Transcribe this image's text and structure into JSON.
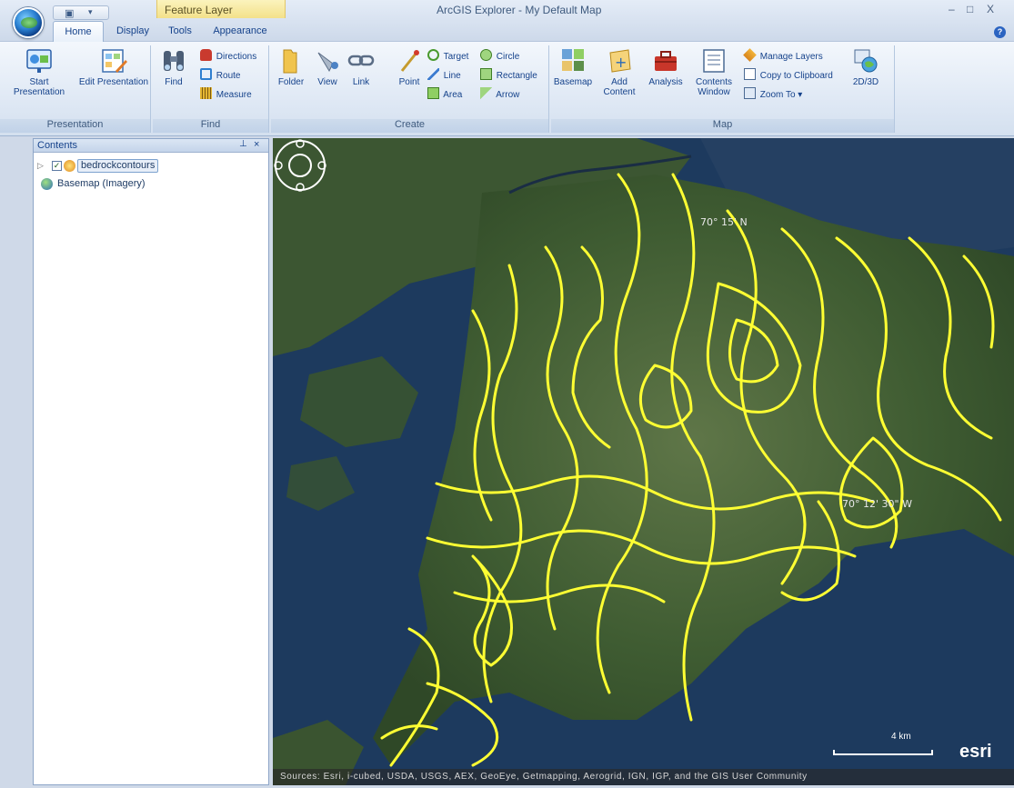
{
  "window": {
    "title": "ArcGIS Explorer - My Default Map",
    "context_tab": "Feature Layer",
    "minimize": "–",
    "maximize": "□",
    "close": "X",
    "help": "?"
  },
  "quick_access": {
    "save": "▣",
    "more": "▾"
  },
  "tabs": [
    {
      "label": "Home",
      "active": true
    },
    {
      "label": "Display"
    },
    {
      "label": "Tools"
    },
    {
      "label": "Appearance"
    }
  ],
  "ribbon": {
    "presentation": {
      "label": "Presentation",
      "start": "Start Presentation",
      "edit": "Edit Presentation"
    },
    "find": {
      "label": "Find",
      "find": "Find",
      "directions": "Directions",
      "route": "Route",
      "measure": "Measure"
    },
    "create": {
      "label": "Create",
      "folder": "Folder",
      "view": "View",
      "link": "Link",
      "point": "Point",
      "target": "Target",
      "line": "Line",
      "area": "Area",
      "circle": "Circle",
      "rectangle": "Rectangle",
      "arrow": "Arrow"
    },
    "map": {
      "label": "Map",
      "basemap": "Basemap",
      "add_content": "Add Content",
      "analysis": "Analysis",
      "contents_window": "Contents Window",
      "manage_layers": "Manage Layers",
      "copy_clipboard": "Copy to Clipboard",
      "zoom_to": "Zoom To",
      "view_2d3d": "2D/3D"
    }
  },
  "contents": {
    "title": "Contents",
    "pin": "📌",
    "close": "×",
    "items": [
      {
        "name": "bedrockcontours",
        "checked": true,
        "expand": "▷",
        "check_mark": "✓"
      },
      {
        "name": "Basemap (Imagery)"
      }
    ]
  },
  "map": {
    "coord_labels": [
      "70° 15' N",
      "70° 12' 30\" W"
    ],
    "scale_label": "4 km",
    "logo": "esri",
    "attribution": "Sources: Esri, i-cubed, USDA, USGS, AEX, GeoEye, Getmapping, Aerogrid, IGN, IGP, and the GIS User Community",
    "contour_color": "#ffff33"
  }
}
